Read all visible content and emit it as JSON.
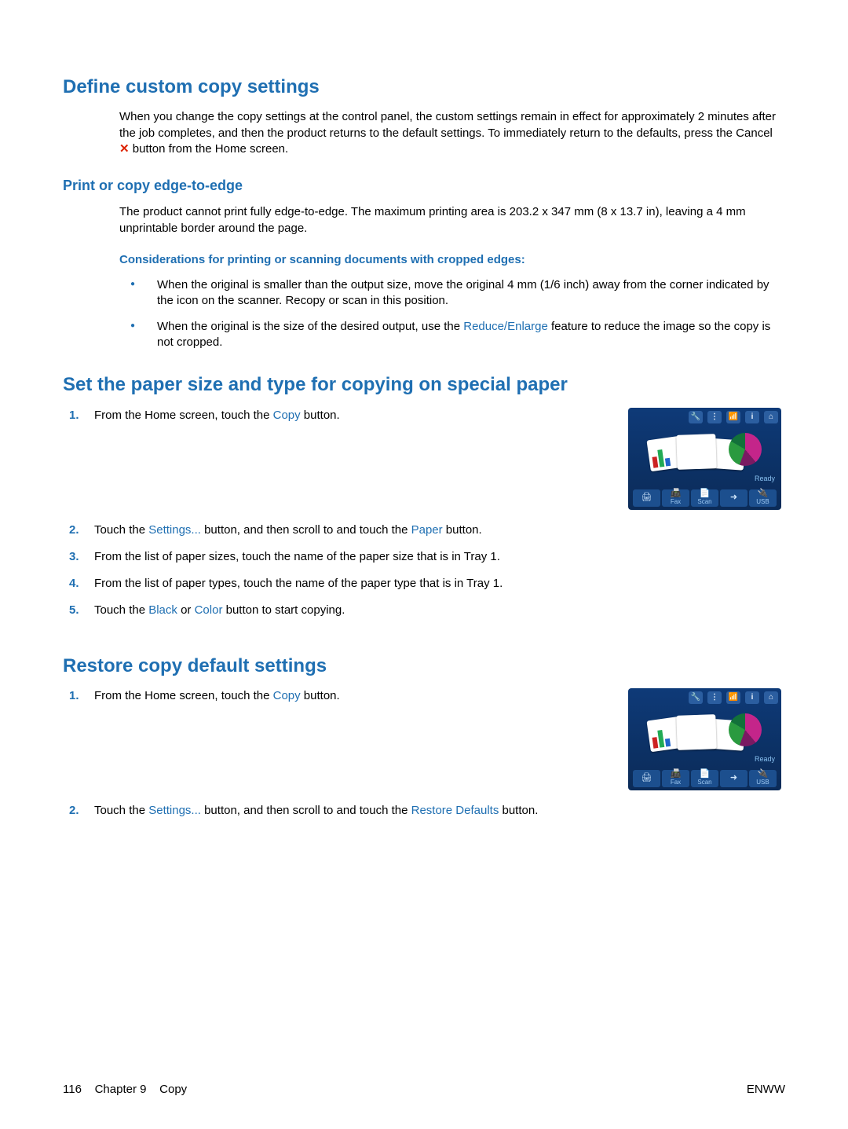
{
  "section1": {
    "heading": "Define custom copy settings",
    "para_before": "When you change the copy settings at the control panel, the custom settings remain in effect for approximately 2 minutes after the job completes, and then the product returns to the default settings. To immediately return to the defaults, press the Cancel ",
    "para_after": " button from the Home screen.",
    "sub_heading": "Print or copy edge-to-edge",
    "sub_para": "The product cannot print fully edge-to-edge. The maximum printing area is 203.2 x 347 mm (8 x 13.7 in), leaving a 4 mm unprintable border around the page.",
    "inline_heading": "Considerations for printing or scanning documents with cropped edges:",
    "bullets": [
      {
        "text": "When the original is smaller than the output size, move the original 4 mm (1/6 inch) away from the corner indicated by the icon on the scanner. Recopy or scan in this position."
      },
      {
        "before": "When the original is the size of the desired output, use the ",
        "link": "Reduce/Enlarge",
        "after": " feature to reduce the image so the copy is not cropped."
      }
    ]
  },
  "section2": {
    "heading": "Set the paper size and type for copying on special paper",
    "steps": [
      {
        "before": "From the Home screen, touch the ",
        "l1": "Copy",
        "mid1": " button."
      },
      {
        "before": "Touch the ",
        "l1": "Settings...",
        "mid1": " button, and then scroll to and touch the ",
        "l2": "Paper",
        "after": " button."
      },
      {
        "before": "From the list of paper sizes, touch the name of the paper size that is in Tray 1."
      },
      {
        "before": "From the list of paper types, touch the name of the paper type that is in Tray 1."
      },
      {
        "before": "Touch the ",
        "l1": "Black",
        "mid1": " or ",
        "l2": "Color",
        "after": " button to start copying."
      }
    ]
  },
  "section3": {
    "heading": "Restore copy default settings",
    "steps": [
      {
        "before": "From the Home screen, touch the ",
        "l1": "Copy",
        "mid1": " button."
      },
      {
        "before": "Touch the ",
        "l1": "Settings...",
        "mid1": " button, and then scroll to and touch the ",
        "l2": "Restore Defaults",
        "after": " button."
      }
    ]
  },
  "panel": {
    "top_icons": [
      "🔧",
      "⋮",
      "📶",
      "i",
      "⌂"
    ],
    "ready": "Ready",
    "bottom": [
      {
        "glyph": "🖨",
        "label": ""
      },
      {
        "glyph": "📠",
        "label": "Fax"
      },
      {
        "glyph": "📄",
        "label": "Scan"
      },
      {
        "glyph": "➜",
        "label": ""
      },
      {
        "glyph": "🔌",
        "label": "USB"
      }
    ]
  },
  "footer": {
    "page_num": "116",
    "chapter": "Chapter 9",
    "title": "Copy",
    "right": "ENWW"
  }
}
